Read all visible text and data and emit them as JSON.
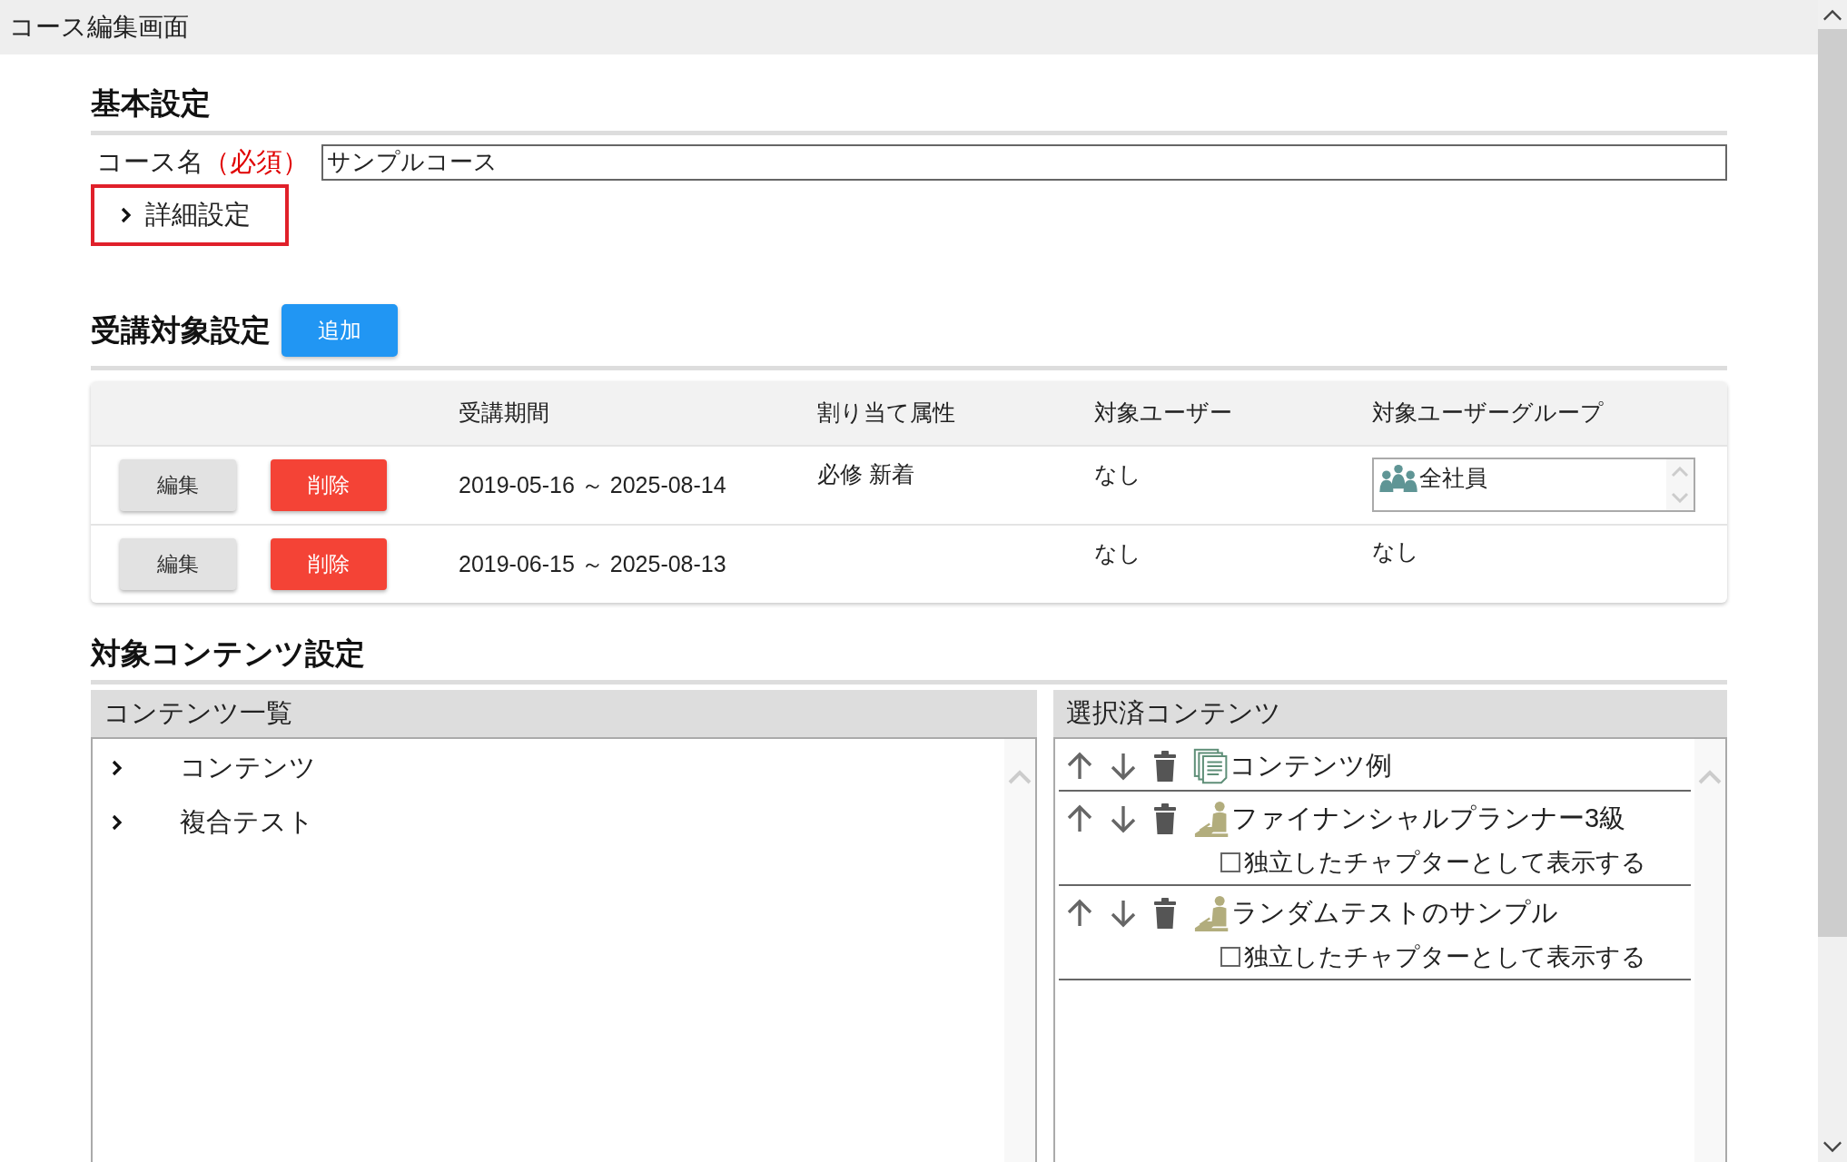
{
  "window": {
    "title": "コース編集画面"
  },
  "basic_settings": {
    "heading": "基本設定",
    "course_name": {
      "label": "コース名",
      "required_mark": "（必須）",
      "value": "サンプルコース"
    },
    "details_toggle": {
      "label": "詳細設定",
      "expanded": false
    }
  },
  "target_settings": {
    "heading": "受講対象設定",
    "add_button": "追加",
    "table": {
      "columns": [
        "受講期間",
        "割り当て属性",
        "対象ユーザー",
        "対象ユーザーグループ"
      ],
      "rows": [
        {
          "edit_button": "編集",
          "delete_button": "削除",
          "period": "2019-05-16 ～ 2025-08-14",
          "attributes": "必修 新着",
          "users": "なし",
          "groups": {
            "kind": "list",
            "items": [
              "全社員"
            ]
          }
        },
        {
          "edit_button": "編集",
          "delete_button": "削除",
          "period": "2019-06-15 ～ 2025-08-13",
          "users": "なし",
          "groups": {
            "kind": "text",
            "text": "なし"
          }
        }
      ]
    }
  },
  "content_settings": {
    "heading": "対象コンテンツ設定",
    "content_list": {
      "title": "コンテンツ一覧",
      "items": [
        {
          "label": "コンテンツ",
          "expanded": false
        },
        {
          "label": "複合テスト",
          "expanded": false
        }
      ]
    },
    "selected_contents": {
      "title": "選択済コンテンツ",
      "items": [
        {
          "kind": "document",
          "name": "コンテンツ例"
        },
        {
          "kind": "test",
          "name": "ファイナンシャルプランナー3級",
          "chapter_option": {
            "label": "独立したチャプターとして表示する",
            "checked": false
          }
        },
        {
          "kind": "test",
          "name": "ランダムテストのサンプル",
          "chapter_option": {
            "label": "独立したチャプターとして表示する",
            "checked": false
          }
        }
      ]
    }
  }
}
